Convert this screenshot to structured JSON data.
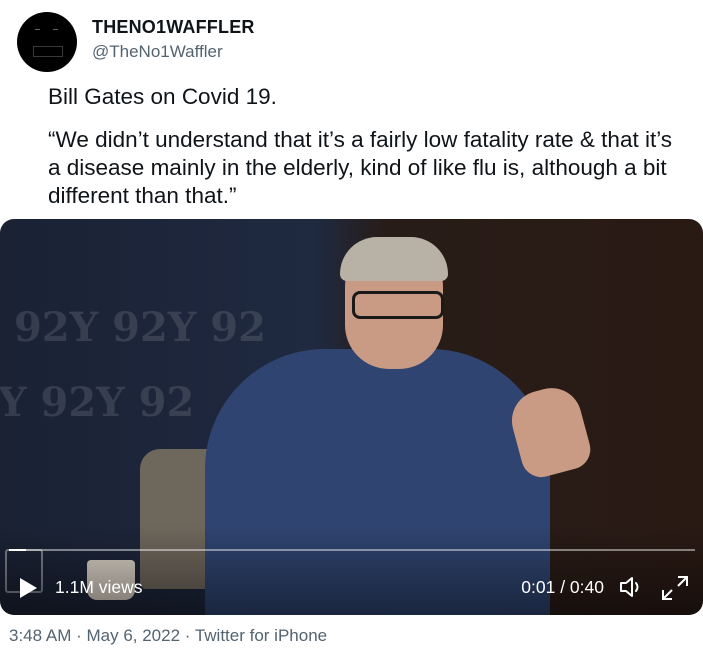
{
  "author": {
    "display_name": "THENO1WAFFLER",
    "handle": "@TheNo1Waffler"
  },
  "tweet": {
    "line1": "Bill Gates on Covid 19.",
    "quote": "“We didn’t understand that it’s a fairly low fatality rate & that it’s a disease mainly in the elderly, kind of like flu is, although a bit different than that.”"
  },
  "video": {
    "views": "1.1M views",
    "time": "0:01 / 0:40",
    "progress_fraction": 0.025,
    "watermark_row1": "92Y 92Y 92",
    "watermark_row2": "Y 92Y 92",
    "icons": [
      "play-icon",
      "volume-icon",
      "fullscreen-icon"
    ]
  },
  "meta": {
    "timestamp": "3:48 AM · May 6, 2022 · Twitter for iPhone"
  }
}
